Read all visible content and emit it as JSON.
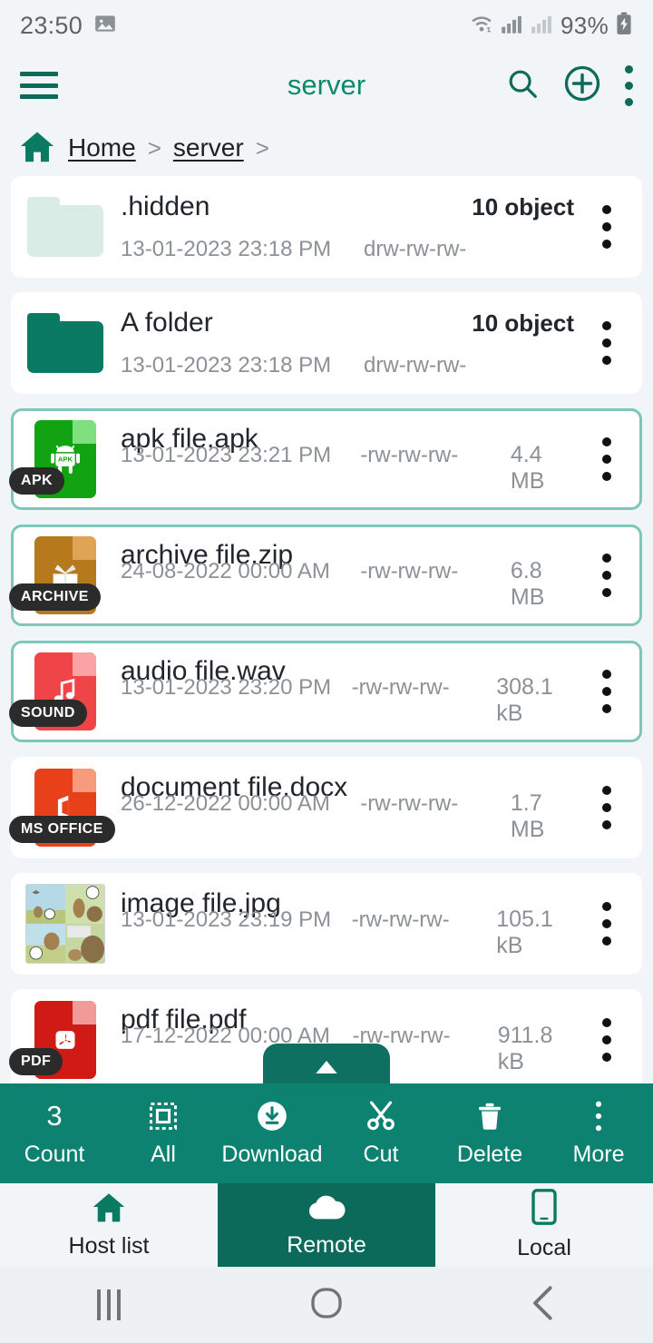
{
  "status_bar": {
    "time": "23:50",
    "battery_percent": "93%",
    "icons": [
      "image-icon",
      "wifi-icon",
      "signal-icon",
      "signal-secondary-icon",
      "battery-charging-icon"
    ]
  },
  "app_bar": {
    "title": "server",
    "menu_icon": "hamburger-icon",
    "search_icon": "search-icon",
    "add_icon": "plus-circle-icon",
    "overflow_icon": "overflow-menu-icon"
  },
  "breadcrumb": {
    "home_icon": "home-icon",
    "items": [
      {
        "label": "Home",
        "separator": ">"
      },
      {
        "label": "server",
        "separator": ">"
      }
    ]
  },
  "files": [
    {
      "name": ".hidden",
      "date": "13-01-2023 23:18 PM",
      "permissions": "drw-rw-rw-",
      "size": "",
      "count": "10 object",
      "type": "folder",
      "icon": "folder-hidden-icon",
      "badge": "",
      "selected": false,
      "color": "#d9ece6"
    },
    {
      "name": "A folder",
      "date": "13-01-2023 23:18 PM",
      "permissions": "drw-rw-rw-",
      "size": "",
      "count": "10 object",
      "type": "folder",
      "icon": "folder-icon",
      "badge": "",
      "selected": false,
      "color": "#0b7a63"
    },
    {
      "name": "apk file.apk",
      "date": "13-01-2023 23:21 PM",
      "permissions": "-rw-rw-rw-",
      "size": "4.4 MB",
      "count": "",
      "type": "apk",
      "icon": "android-apk-icon",
      "badge": "APK",
      "selected": true,
      "color": "#12a312"
    },
    {
      "name": "archive file.zip",
      "date": "24-08-2022 00:00 AM",
      "permissions": "-rw-rw-rw-",
      "size": "6.8 MB",
      "count": "",
      "type": "archive",
      "icon": "archive-box-icon",
      "badge": "ARCHIVE",
      "selected": true,
      "color": "#b6791c"
    },
    {
      "name": "audio file.wav",
      "date": "13-01-2023 23:20 PM",
      "permissions": "-rw-rw-rw-",
      "size": "308.1 kB",
      "count": "",
      "type": "sound",
      "icon": "music-note-icon",
      "badge": "SOUND",
      "selected": true,
      "color": "#ef4448"
    },
    {
      "name": "document file.docx",
      "date": "26-12-2022 00:00 AM",
      "permissions": "-rw-rw-rw-",
      "size": "1.7 MB",
      "count": "",
      "type": "office",
      "icon": "ms-office-icon",
      "badge": "MS OFFICE",
      "selected": false,
      "color": "#e8411a"
    },
    {
      "name": "image file.jpg",
      "date": "13-01-2023 23:19 PM",
      "permissions": "-rw-rw-rw-",
      "size": "105.1 kB",
      "count": "",
      "type": "image",
      "icon": "image-thumbnail",
      "badge": "",
      "selected": false,
      "color": "#9fc6d8"
    },
    {
      "name": "pdf file.pdf",
      "date": "17-12-2022 00:00 AM",
      "permissions": "-rw-rw-rw-",
      "size": "911.8 kB",
      "count": "",
      "type": "pdf",
      "icon": "pdf-icon",
      "badge": "PDF",
      "selected": false,
      "color": "#d01a16"
    }
  ],
  "scroll_up": {
    "icon": "chevron-up-icon"
  },
  "action_bar": {
    "count_value": "3",
    "items": [
      {
        "label": "Count",
        "icon": "count-number"
      },
      {
        "label": "All",
        "icon": "select-all-icon"
      },
      {
        "label": "Download",
        "icon": "download-icon"
      },
      {
        "label": "Cut",
        "icon": "scissors-icon"
      },
      {
        "label": "Delete",
        "icon": "trash-icon"
      },
      {
        "label": "More",
        "icon": "overflow-menu-icon"
      }
    ]
  },
  "bottom_tabs": [
    {
      "label": "Host list",
      "icon": "home-icon",
      "active": false
    },
    {
      "label": "Remote",
      "icon": "cloud-icon",
      "active": true
    },
    {
      "label": "Local",
      "icon": "phone-icon",
      "active": false
    }
  ],
  "android_nav": [
    {
      "name": "recents-button",
      "icon": "recents-icon"
    },
    {
      "name": "home-button",
      "icon": "circle-icon"
    },
    {
      "name": "back-button",
      "icon": "back-chevron-icon"
    }
  ],
  "colors": {
    "brand": "#0b8a6e",
    "action_bar": "#0d8270",
    "tab_active": "#0b6a59",
    "selected_border": "#7ec6b9",
    "page_bg": "#f2f5f7"
  }
}
